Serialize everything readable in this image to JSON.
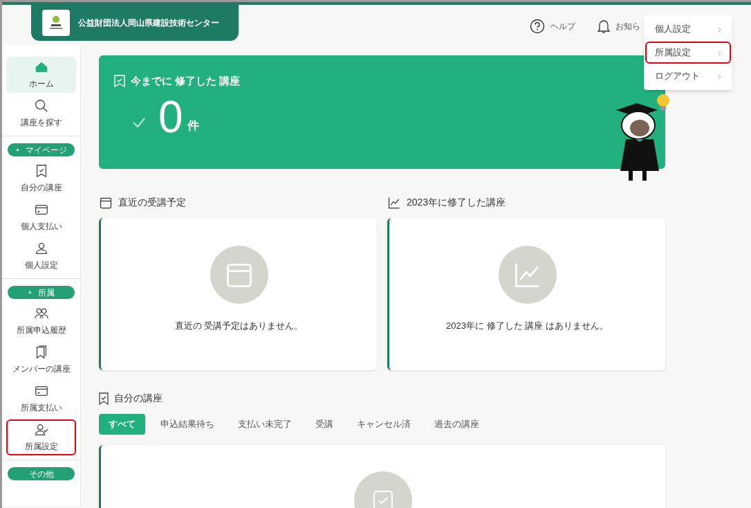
{
  "header": {
    "org_name": "公益財団法人岡山県建設技術センター",
    "help": "ヘルプ",
    "notifications": "お知ら"
  },
  "user_menu": [
    {
      "label": "個人設定",
      "highlighted": false,
      "chevron": "›"
    },
    {
      "label": "所属設定",
      "highlighted": true,
      "chevron": "›"
    },
    {
      "label": "ログアウト",
      "highlighted": false,
      "chevron": "›"
    }
  ],
  "sidebar": {
    "top_items": [
      {
        "label": "ホーム",
        "kind": "home",
        "selected": true,
        "highlighted": false
      },
      {
        "label": "講座を探す",
        "kind": "search",
        "selected": false,
        "highlighted": false
      }
    ],
    "groups": [
      {
        "label": "マイページ",
        "marker": "▲",
        "items": [
          {
            "label": "自分の講座",
            "kind": "bookmark-check",
            "selected": false,
            "highlighted": false
          },
          {
            "label": "個人支払い",
            "kind": "card",
            "selected": false,
            "highlighted": false
          },
          {
            "label": "個人設定",
            "kind": "person",
            "selected": false,
            "highlighted": false
          }
        ]
      },
      {
        "label": "所属",
        "marker": "▲",
        "items": [
          {
            "label": "所属申込履歴",
            "kind": "people",
            "selected": false,
            "highlighted": false
          },
          {
            "label": "メンバーの講座",
            "kind": "bookmarks",
            "selected": false,
            "highlighted": false
          },
          {
            "label": "所属支払い",
            "kind": "card",
            "selected": false,
            "highlighted": false
          },
          {
            "label": "所属設定",
            "kind": "person-check",
            "selected": false,
            "highlighted": true
          }
        ]
      },
      {
        "label": "その他"
      }
    ]
  },
  "summary": {
    "title": "今までに 修了した 講座",
    "count": "0",
    "unit": "件"
  },
  "panels": [
    {
      "title": "直近の受講予定",
      "kind": "calendar",
      "empty_message": "直近の 受講予定はありません。"
    },
    {
      "title": "2023年に修了した講座",
      "kind": "chart",
      "empty_message": "2023年に 修了した 講座 はありません。"
    }
  ],
  "my_courses": {
    "title": "自分の講座",
    "tabs": [
      {
        "label": "すべて",
        "selected": true
      },
      {
        "label": "申込結果待ち",
        "selected": false
      },
      {
        "label": "支払い未完了",
        "selected": false
      },
      {
        "label": "受講",
        "selected": false
      },
      {
        "label": "キャンセル済",
        "selected": false
      },
      {
        "label": "過去の講座",
        "selected": false
      }
    ]
  }
}
